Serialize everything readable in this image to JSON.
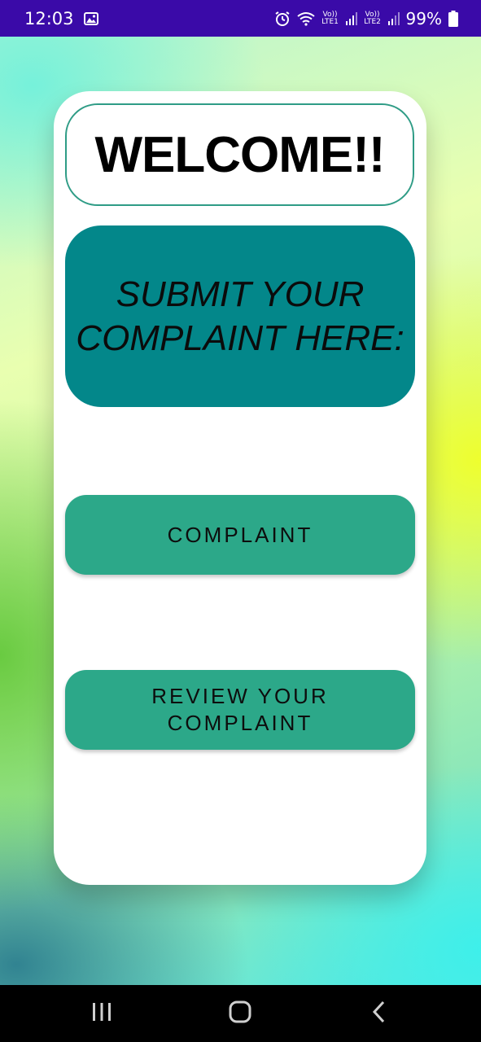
{
  "status_bar": {
    "time": "12:03",
    "sim1_label": "Vo)) LTE1",
    "sim2_label": "Vo)) LTE2",
    "battery": "99%",
    "icons": [
      "gallery-icon",
      "alarm-icon",
      "wifi-icon",
      "signal-icon",
      "battery-icon"
    ]
  },
  "card": {
    "welcome": "WELCOME!!",
    "submit_heading": "SUBMIT YOUR COMPLAINT HERE:",
    "buttons": {
      "complaint": "COMPLAINT",
      "review": "REVIEW YOUR COMPLAINT"
    }
  },
  "nav_bar": {
    "icons": [
      "recent-apps-icon",
      "home-icon",
      "back-icon"
    ]
  },
  "colors": {
    "status_bar": "#3a0aa8",
    "submit_box": "#03878a",
    "button": "#2ca889",
    "welcome_border": "#2f9c86"
  }
}
